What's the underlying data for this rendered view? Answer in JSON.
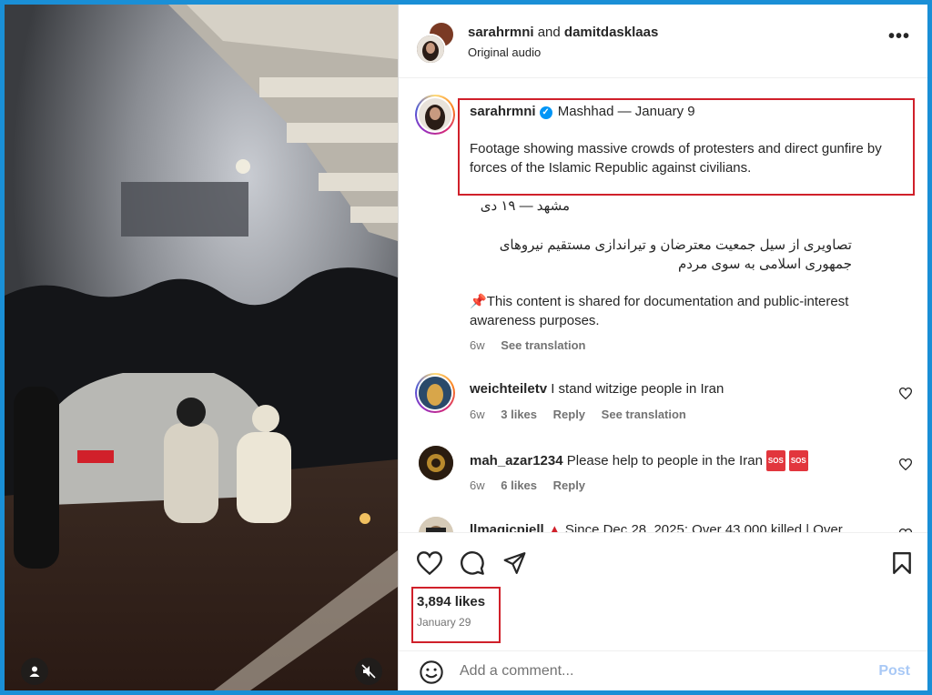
{
  "header": {
    "user1": "sarahrmni",
    "conjunction": "and",
    "user2": "damitdasklaas",
    "audio": "Original audio",
    "more_label": "•••"
  },
  "caption": {
    "username": "sarahrmni",
    "location_date": "Mashhad — January 9",
    "text_en": "Footage showing massive crowds of protesters and direct gunfire by forces of the Islamic Republic against civilians.",
    "location_fa": "مشهد — ۱۹ دی",
    "text_fa": "تصاویری از سیل جمعیت معترضان و تیراندازی مستقیم نیروهای جمهوری اسلامی به سوی مردم",
    "notice_icon": "📌",
    "notice": "This content is shared for documentation and public-interest awareness purposes.",
    "age": "6w",
    "see_translation": "See translation"
  },
  "comments": [
    {
      "username": "weichteiletv",
      "text": "I stand witzige people in Iran",
      "age": "6w",
      "likes": "3 likes",
      "reply": "Reply",
      "see_translation": "See translation"
    },
    {
      "username": "mah_azar1234",
      "text": "Please help to people in the Iran",
      "badge": "SOS",
      "age": "6w",
      "likes": "6 likes",
      "reply": "Reply"
    },
    {
      "username": "llmagicpiell",
      "text": "Since Dec 28, 2025: Over 43,000 killed | Over"
    }
  ],
  "post": {
    "likes": "3,894 likes",
    "date": "January 29"
  },
  "add_comment": {
    "placeholder": "Add a comment...",
    "post_label": "Post"
  },
  "colors": {
    "accent_blue": "#0095f6",
    "highlight_red": "#d0202a",
    "border_blue": "#1a8fd6"
  }
}
